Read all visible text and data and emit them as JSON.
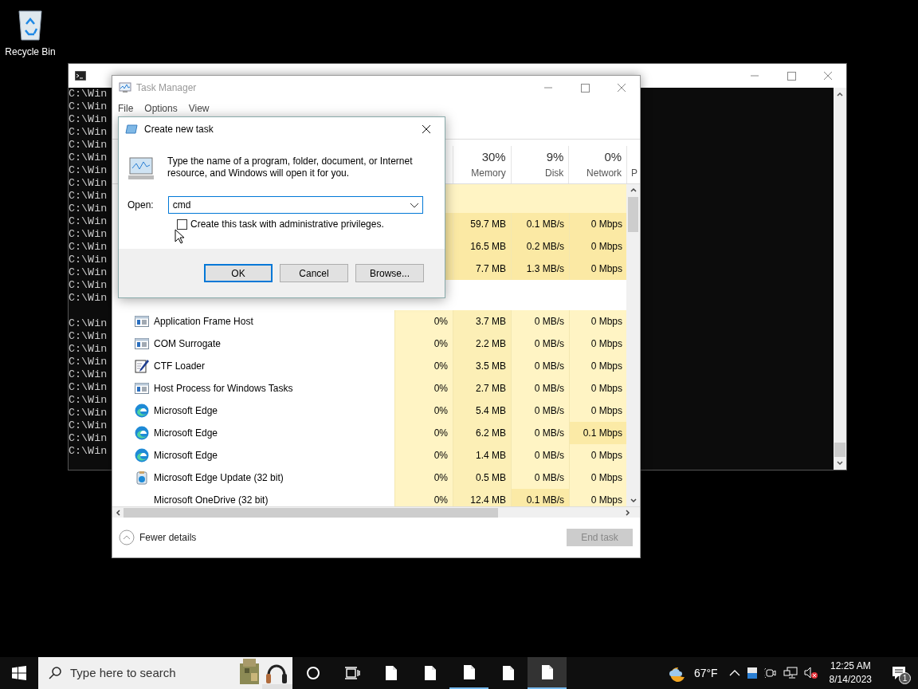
{
  "desktop_icons": [
    {
      "label": "Recycle Bin"
    }
  ],
  "cmd_window": {
    "line_groups": [
      [
        "C:\\Win",
        "C:\\Win",
        "C:\\Win",
        "C:\\Win",
        "C:\\Win",
        "C:\\Win",
        "C:\\Win",
        "C:\\Win",
        "C:\\Win",
        "C:\\Win",
        "C:\\Win",
        "C:\\Win",
        "C:\\Win",
        "C:\\Win",
        "C:\\Win",
        "C:\\Win",
        "C:\\Win"
      ],
      [
        "C:\\Win",
        "C:\\Win",
        "C:\\Win",
        "C:\\Win",
        "C:\\Win",
        "C:\\Win",
        "C:\\Win",
        "C:\\Win",
        "C:\\Win",
        "C:\\Win",
        "C:\\Win"
      ]
    ]
  },
  "task_manager": {
    "title": "Task Manager",
    "menu": [
      "File",
      "Options",
      "View"
    ],
    "columns": [
      {
        "percent": "30%",
        "label": "Memory"
      },
      {
        "percent": "9%",
        "label": "Disk"
      },
      {
        "percent": "0%",
        "label": "Network"
      },
      {
        "label": "P"
      }
    ],
    "app_rows": [
      {
        "memory": "59.7 MB",
        "disk": "0.1 MB/s",
        "network": "0 Mbps"
      },
      {
        "memory": "16.5 MB",
        "disk": "0.2 MB/s",
        "network": "0 Mbps"
      },
      {
        "memory": "7.7 MB",
        "disk": "1.3 MB/s",
        "network": "0 Mbps"
      }
    ],
    "processes": [
      {
        "name": "Application Frame Host",
        "kind": "window",
        "cpu": "0%",
        "memory": "3.7 MB",
        "disk": "0 MB/s",
        "network": "0 Mbps"
      },
      {
        "name": "COM Surrogate",
        "kind": "window",
        "cpu": "0%",
        "memory": "2.2 MB",
        "disk": "0 MB/s",
        "network": "0 Mbps"
      },
      {
        "name": "CTF Loader",
        "kind": "pen",
        "cpu": "0%",
        "memory": "3.5 MB",
        "disk": "0 MB/s",
        "network": "0 Mbps"
      },
      {
        "name": "Host Process for Windows Tasks",
        "kind": "window",
        "cpu": "0%",
        "memory": "2.7 MB",
        "disk": "0 MB/s",
        "network": "0 Mbps"
      },
      {
        "name": "Microsoft Edge",
        "kind": "edge",
        "cpu": "0%",
        "memory": "5.4 MB",
        "disk": "0 MB/s",
        "network": "0 Mbps"
      },
      {
        "name": "Microsoft Edge",
        "kind": "edge",
        "cpu": "0%",
        "memory": "6.2 MB",
        "disk": "0 MB/s",
        "network": "0.1 Mbps"
      },
      {
        "name": "Microsoft Edge",
        "kind": "edge",
        "cpu": "0%",
        "memory": "1.4 MB",
        "disk": "0 MB/s",
        "network": "0 Mbps"
      },
      {
        "name": "Microsoft Edge Update (32 bit)",
        "kind": "installer",
        "cpu": "0%",
        "memory": "0.5 MB",
        "disk": "0 MB/s",
        "network": "0 Mbps"
      },
      {
        "name": "Microsoft OneDrive (32 bit)",
        "kind": "plain",
        "cpu": "0%",
        "memory": "12.4 MB",
        "disk": "0.1 MB/s",
        "network": "0 Mbps"
      }
    ],
    "fewer_details": "Fewer details",
    "end_task": {
      "label": "End task",
      "disabled": true
    }
  },
  "dialog": {
    "title": "Create new task",
    "message": "Type the name of a program, folder, document, or Internet resource, and Windows will open it for you.",
    "open_label": "Open:",
    "value": "cmd",
    "checkbox": {
      "label": "Create this task with administrative privileges.",
      "checked": false
    },
    "buttons": [
      {
        "label": "OK",
        "default": true
      },
      {
        "label": "Cancel",
        "default": false
      },
      {
        "label": "Browse...",
        "default": false
      }
    ]
  },
  "taskbar": {
    "search_placeholder": "Type here to search",
    "apps": [
      {
        "running": false,
        "active": false
      },
      {
        "running": false,
        "active": false
      },
      {
        "running": true,
        "active": false
      },
      {
        "running": false,
        "active": false
      },
      {
        "running": true,
        "active": true
      }
    ],
    "temperature": "67°F",
    "time": "12:25 AM",
    "date": "8/14/2023",
    "notification_count": "1"
  }
}
